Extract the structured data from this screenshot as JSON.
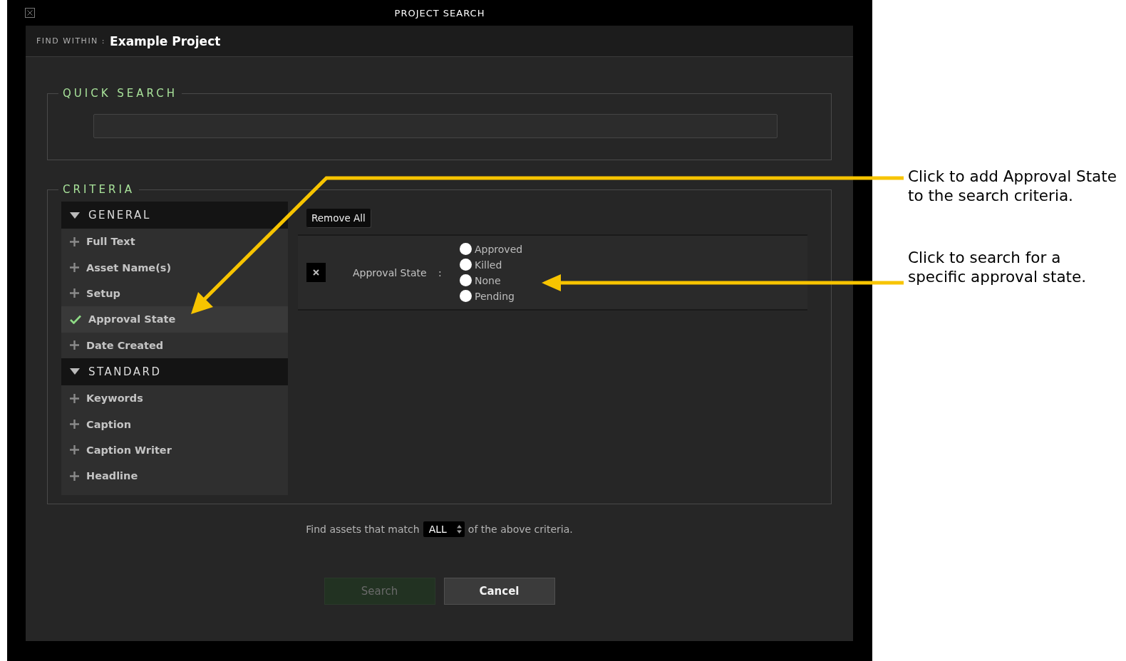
{
  "window": {
    "title": "PROJECT SEARCH"
  },
  "find_within": {
    "label": "FIND WITHIN :",
    "value": "Example Project"
  },
  "quick_search": {
    "title": "QUICK SEARCH"
  },
  "criteria": {
    "title": "CRITERIA",
    "groups": [
      {
        "label": "GENERAL",
        "expanded": true,
        "items": [
          {
            "label": "Full Text",
            "selected": false
          },
          {
            "label": "Asset Name(s)",
            "selected": false
          },
          {
            "label": "Setup",
            "selected": false
          },
          {
            "label": "Approval State",
            "selected": true
          },
          {
            "label": "Date Created",
            "selected": false
          }
        ]
      },
      {
        "label": "STANDARD",
        "expanded": true,
        "items": [
          {
            "label": "Keywords",
            "selected": false
          },
          {
            "label": "Caption",
            "selected": false
          },
          {
            "label": "Caption Writer",
            "selected": false
          },
          {
            "label": "Headline",
            "selected": false
          }
        ]
      }
    ],
    "remove_all": "Remove All",
    "rows": [
      {
        "label": "Approval State",
        "separator": ":",
        "options": [
          {
            "label": "Approved",
            "selected": false
          },
          {
            "label": "Killed",
            "selected": false
          },
          {
            "label": "None",
            "selected": false
          },
          {
            "label": "Pending",
            "selected": false
          }
        ]
      }
    ]
  },
  "match": {
    "before": "Find assets that match",
    "value": "ALL",
    "after": "of the above criteria."
  },
  "buttons": [
    {
      "label": "Search",
      "disabled": true
    },
    {
      "label": "Cancel",
      "disabled": false
    }
  ],
  "annotations": [
    {
      "text": "Click to add Approval State to the search criteria."
    },
    {
      "text": "Click to search for a specific approval state."
    }
  ]
}
